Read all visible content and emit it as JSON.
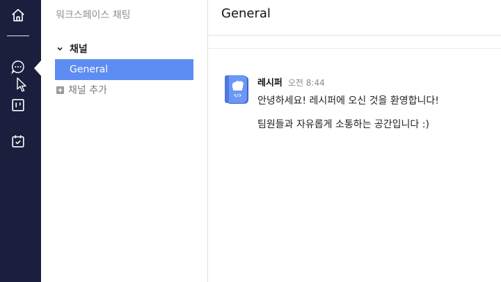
{
  "rail": {
    "icons": [
      "home-icon",
      "chat-icon",
      "board-icon",
      "calendar-icon"
    ]
  },
  "sidebar": {
    "workspace_title": "워크스페이스 채팅",
    "section_title": "채널",
    "channels": [
      {
        "label": "General",
        "selected": true
      }
    ],
    "add_channel_label": "채널 추가"
  },
  "main": {
    "channel_title": "General",
    "messages": [
      {
        "author": "레시퍼",
        "time": "오전 8:44",
        "lines": [
          "안녕하세요! 레시퍼에 오신 것을 환영합니다!",
          "팀원들과 자유롭게 소통하는 공간입니다 :)"
        ]
      }
    ]
  },
  "colors": {
    "rail_bg": "#1b1e3c",
    "selected_channel_bg": "#5d8cf2",
    "avatar_bg": "#5d8cf2"
  }
}
